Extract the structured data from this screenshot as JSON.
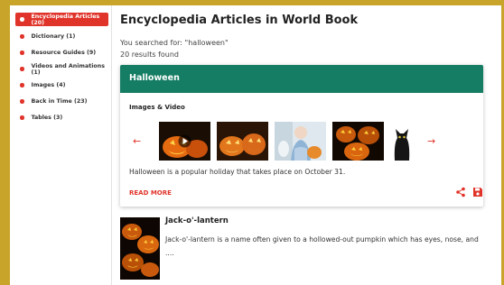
{
  "sidebar": {
    "items": [
      {
        "label": "Encyclopedia Articles (20)",
        "active": true
      },
      {
        "label": "Dictionary (1)",
        "active": false
      },
      {
        "label": "Resource Guides (9)",
        "active": false
      },
      {
        "label": "Videos and Animations (1)",
        "active": false
      },
      {
        "label": "Images (4)",
        "active": false
      },
      {
        "label": "Back in Time (23)",
        "active": false
      },
      {
        "label": "Tables (3)",
        "active": false
      }
    ]
  },
  "main": {
    "title": "Encyclopedia Articles in World Book",
    "searched": "You searched for: \"halloween\"",
    "count": "20 results found"
  },
  "card": {
    "title": "Halloween",
    "images_title": "Images & Video",
    "summary": "Halloween is a popular holiday that takes place on October 31.",
    "read_more": "READ MORE",
    "thumbnails": [
      "pumpkin-video",
      "jack-o-lanterns",
      "costume-child",
      "lit-pumpkins",
      "black-cat"
    ]
  },
  "result": {
    "title": "Jack-o'-lantern",
    "description": "Jack-o'-lantern is a name often given to a hollowed-out pumpkin which has eyes, nose, and ...."
  },
  "colors": {
    "accent": "#e0342a",
    "header_green": "#157d63",
    "frame_gold": "#c8a52a"
  }
}
